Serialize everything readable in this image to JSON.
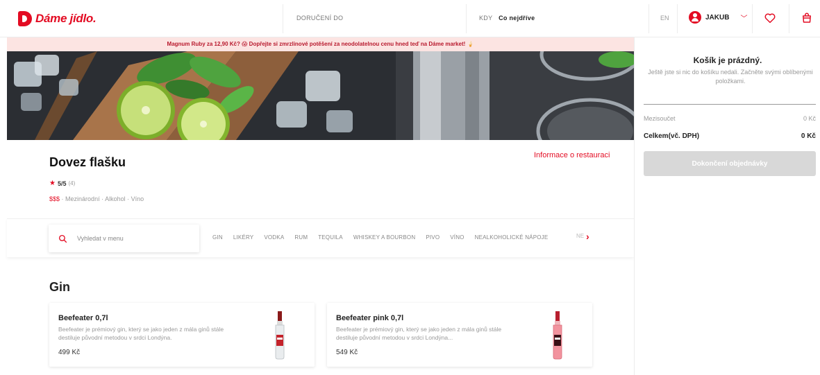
{
  "header": {
    "logo_text": "Dáme jídlo.",
    "delivery_label": "DORUČENÍ DO",
    "when_label": "KDY",
    "when_value": "Co nejdříve",
    "language": "EN",
    "user_name": "JAKUB"
  },
  "promo": {
    "text": "Magnum Ruby za 12,90 Kč? 😱 Dopřejte si zmrzlinové potěšení za neodolatelnou cenu hned teď na Dáme market! 🍦"
  },
  "restaurant": {
    "name": "Dovez flašku",
    "info_link": "Informace o restauraci",
    "rating_score": "5/5",
    "rating_count": "(4)",
    "price_level": "$$$",
    "cuisines": "· Mezinárodní · Alkohol · Víno"
  },
  "menu_nav": {
    "search_placeholder": "Vyhledat v menu",
    "categories": [
      "GIN",
      "LIKÉRY",
      "VODKA",
      "RUM",
      "TEQUILA",
      "WHISKEY A BOURBON",
      "PIVO",
      "VÍNO",
      "NEALKOHOLICKÉ NÁPOJE"
    ],
    "categories_overflow": "NE"
  },
  "section": {
    "title": "Gin",
    "products": [
      {
        "name": "Beefeater 0,7l",
        "description": "Beefeater je prémiový gin, který se jako jeden z mála ginů stále destiluje původní metodou v srdci Londýna.",
        "price": "499 Kč"
      },
      {
        "name": "Beefeater pink 0,7l",
        "description": "Beefeater je prémiový gin, který se jako jeden z mála ginů stále destiluje původní metodou v srdci Londýna...",
        "price": "549 Kč"
      }
    ]
  },
  "cart": {
    "title": "Košík je prázdný.",
    "subtitle": "Ještě jste si nic do košíku nedali. Začněte svými oblíbenými položkami.",
    "subtotal_label": "Mezisoučet",
    "subtotal_value": "0 Kč",
    "total_label": "Celkem(vč. DPH)",
    "total_value": "0 Kč",
    "checkout_label": "Dokončení objednávky"
  },
  "colors": {
    "brand_red": "#e30c23",
    "promo_bg": "#fce4e2",
    "disabled_button": "#d8d8d8"
  },
  "icons": [
    "logo-icon",
    "user-icon",
    "chevron-down-icon",
    "heart-icon",
    "bag-icon",
    "search-icon",
    "star-icon",
    "chevron-right-icon"
  ]
}
